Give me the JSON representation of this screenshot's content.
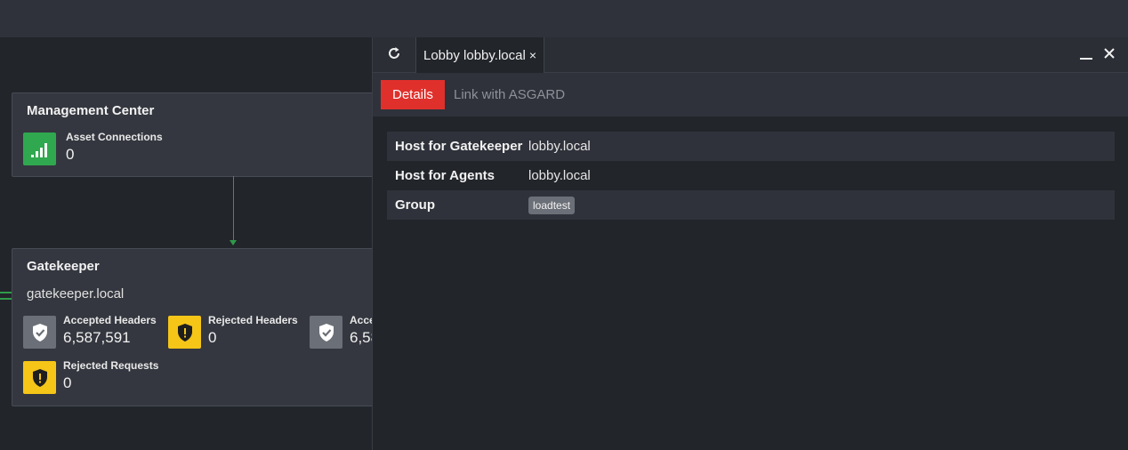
{
  "canvas": {
    "management_center": {
      "title": "Management Center",
      "metrics": [
        {
          "label": "Asset Connections",
          "value": "0",
          "icon": "signal-bars-icon",
          "color": "#2fa84f"
        }
      ]
    },
    "gatekeeper": {
      "title": "Gatekeeper",
      "host": "gatekeeper.local",
      "metrics": [
        {
          "label": "Accepted Headers",
          "value": "6,587,591",
          "icon": "shield-check-icon",
          "color": "#6b6f77"
        },
        {
          "label": "Rejected Headers",
          "value": "0",
          "icon": "shield-alert-icon",
          "color": "#f5c518"
        },
        {
          "label": "Acce",
          "value": "6,58",
          "icon": "shield-check-icon",
          "color": "#6b6f77"
        },
        {
          "label": "Rejected Requests",
          "value": "0",
          "icon": "shield-alert-icon",
          "color": "#f5c518"
        }
      ]
    }
  },
  "panel": {
    "refresh_icon": "refresh-icon",
    "tab": {
      "label": "Lobby lobby.local",
      "close": "×"
    },
    "window_controls": {
      "minimize_icon": "minimize-icon",
      "close_icon": "close-icon"
    },
    "subtabs": {
      "active": "Details",
      "inactive": "Link with ASGARD"
    },
    "accent_color": "#e0302c",
    "properties": [
      {
        "key": "Host for Gatekeeper",
        "value": "lobby.local"
      },
      {
        "key": "Host for Agents",
        "value": "lobby.local"
      },
      {
        "key": "Group",
        "tag": "loadtest"
      }
    ]
  }
}
